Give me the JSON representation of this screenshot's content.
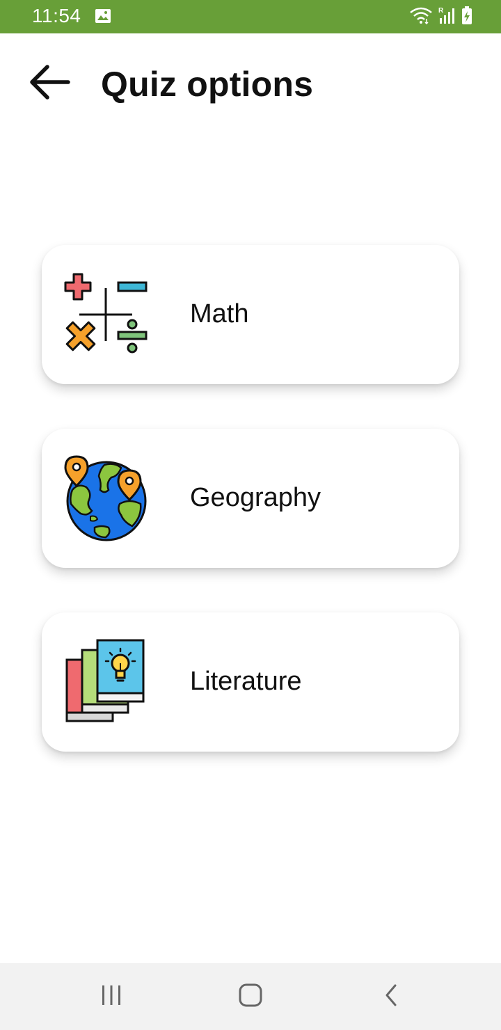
{
  "status_bar": {
    "time": "11:54",
    "icons": [
      "gallery-icon",
      "wifi-icon",
      "signal-icon",
      "battery-charging-icon"
    ],
    "background": "#689f38"
  },
  "app_bar": {
    "title": "Quiz options",
    "back_icon": "arrow-left-icon"
  },
  "options": [
    {
      "label": "Math",
      "icon": "math-operators-icon"
    },
    {
      "label": "Geography",
      "icon": "globe-with-pins-icon"
    },
    {
      "label": "Literature",
      "icon": "books-with-lightbulb-icon"
    }
  ],
  "nav_bar": {
    "buttons": [
      "recent-apps-icon",
      "home-icon",
      "back-icon"
    ]
  }
}
